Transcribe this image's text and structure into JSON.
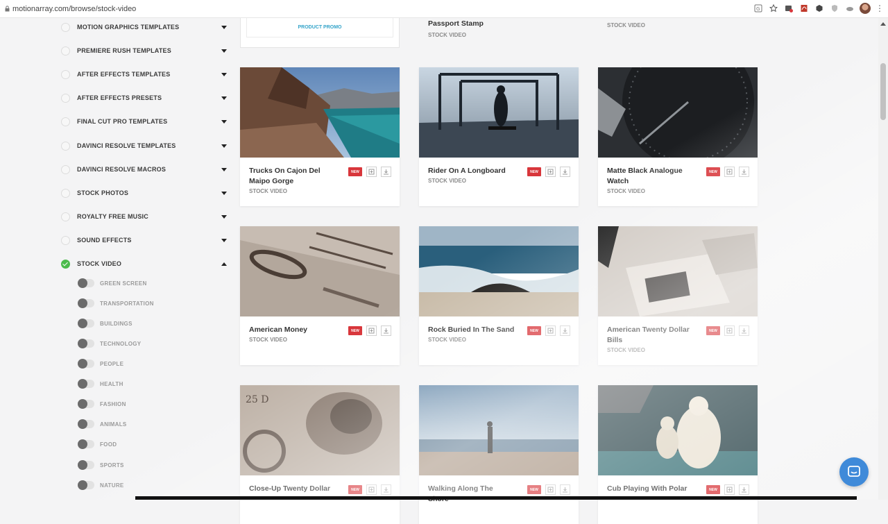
{
  "browser": {
    "url": "motionarray.com/browse/stock-video",
    "extension_icons": [
      "translate-icon",
      "star-icon",
      "extension-badge-icon",
      "pdf-icon",
      "cube-icon",
      "shield-icon",
      "cloud-icon"
    ]
  },
  "sidebar": {
    "categories": [
      {
        "label": "MOTION GRAPHICS TEMPLATES",
        "checked": false,
        "expanded": false
      },
      {
        "label": "PREMIERE RUSH TEMPLATES",
        "checked": false,
        "expanded": false
      },
      {
        "label": "AFTER EFFECTS TEMPLATES",
        "checked": false,
        "expanded": false
      },
      {
        "label": "AFTER EFFECTS PRESETS",
        "checked": false,
        "expanded": false
      },
      {
        "label": "FINAL CUT PRO TEMPLATES",
        "checked": false,
        "expanded": false
      },
      {
        "label": "DAVINCI RESOLVE TEMPLATES",
        "checked": false,
        "expanded": false
      },
      {
        "label": "DAVINCI RESOLVE MACROS",
        "checked": false,
        "expanded": false
      },
      {
        "label": "STOCK PHOTOS",
        "checked": false,
        "expanded": false
      },
      {
        "label": "ROYALTY FREE MUSIC",
        "checked": false,
        "expanded": false
      },
      {
        "label": "SOUND EFFECTS",
        "checked": false,
        "expanded": false
      },
      {
        "label": "STOCK VIDEO",
        "checked": true,
        "expanded": true
      }
    ],
    "subcategories": [
      "GREEN SCREEN",
      "TRANSPORTATION",
      "BUILDINGS",
      "TECHNOLOGY",
      "PEOPLE",
      "HEALTH",
      "FASHION",
      "ANIMALS",
      "FOOD",
      "SPORTS",
      "NATURE"
    ]
  },
  "partial_row": {
    "promo_label": "PRODUCT PROMO",
    "middle_title": "Passport Stamp",
    "middle_type": "STOCK VIDEO",
    "right_type": "STOCK VIDEO"
  },
  "cards": [
    {
      "title": "Trucks On Cajon Del Maipo Gorge",
      "type": "STOCK VIDEO",
      "badge": "NEW"
    },
    {
      "title": "Rider On A Longboard",
      "type": "STOCK VIDEO",
      "badge": "NEW"
    },
    {
      "title": "Matte Black Analogue Watch",
      "type": "STOCK VIDEO",
      "badge": "NEW"
    },
    {
      "title": "American Money",
      "type": "STOCK VIDEO",
      "badge": "NEW"
    },
    {
      "title": "Rock Buried In The Sand",
      "type": "STOCK VIDEO",
      "badge": "NEW"
    },
    {
      "title": "American Twenty Dollar Bills",
      "type": "STOCK VIDEO",
      "badge": "NEW"
    },
    {
      "title": "Close-Up Twenty Dollar",
      "type": "",
      "badge": "NEW"
    },
    {
      "title": "Walking Along The Shore",
      "type": "",
      "badge": "NEW"
    },
    {
      "title": "Cub Playing With Polar",
      "type": "",
      "badge": "NEW"
    }
  ],
  "colors": {
    "accent_new_badge": "#d8363b",
    "check_green": "#4cbb4c",
    "promo_blue": "#33a3c9",
    "chat_button": "#3f8ad9"
  }
}
